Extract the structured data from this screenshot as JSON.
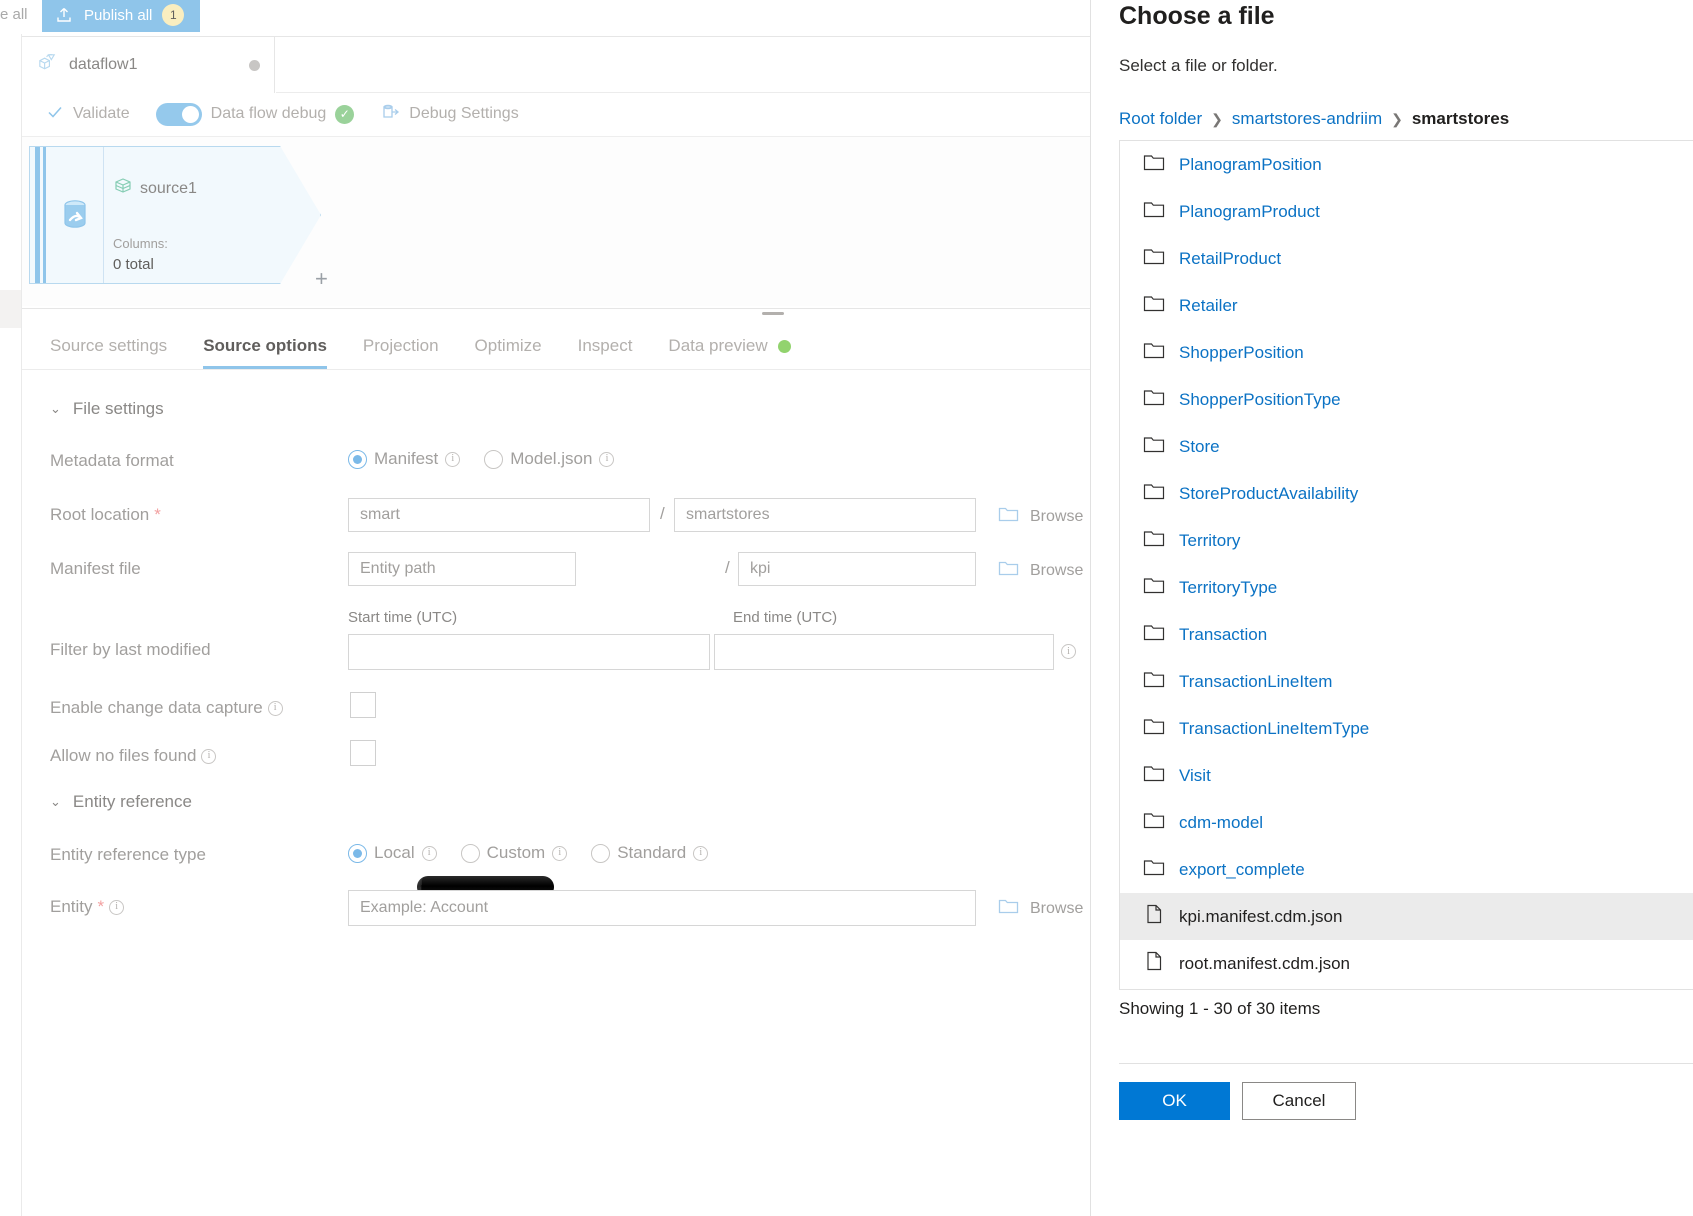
{
  "toolbar": {
    "discard_label": "e all",
    "publish_label": "Publish all",
    "publish_icon": "publish-upload-icon",
    "publish_count": "1"
  },
  "dataflow_tab": {
    "name": "dataflow1",
    "icon": "dataflow-icon",
    "status_dot": "unsaved-dot"
  },
  "command_bar": {
    "validate": {
      "label": "Validate",
      "icon": "check-icon"
    },
    "debug_toggle": {
      "label": "Data flow debug",
      "state": "on",
      "status_icon": "check-circle-green-icon"
    },
    "debug_settings": {
      "label": "Debug Settings",
      "icon": "debug-settings-icon"
    }
  },
  "canvas": {
    "node": {
      "icon": "source-database-icon",
      "side_icon": "source-stream-icon",
      "name": "source1",
      "columns_label": "Columns:",
      "columns_value": "0 total",
      "add_label": "+"
    }
  },
  "detail_tabs": [
    {
      "label": "Source settings",
      "active": false
    },
    {
      "label": "Source options",
      "active": true
    },
    {
      "label": "Projection",
      "active": false
    },
    {
      "label": "Optimize",
      "active": false
    },
    {
      "label": "Inspect",
      "active": false
    },
    {
      "label": "Data preview",
      "active": false,
      "dot": true
    }
  ],
  "form": {
    "file_settings_header": "File settings",
    "entity_reference_header": "Entity reference",
    "metadata_format": {
      "label": "Metadata format",
      "options": [
        {
          "label": "Manifest",
          "selected": true
        },
        {
          "label": "Model.json",
          "selected": false
        }
      ]
    },
    "root_location": {
      "label": "Root location",
      "required": "*",
      "container_value": "smart",
      "container_redacted": true,
      "separator": "/",
      "folder_value": "smartstores",
      "browse_label": "Browse",
      "browse_icon": "folder-icon"
    },
    "manifest_file": {
      "label": "Manifest file",
      "entity_path_placeholder": "Entity path",
      "separator": "/",
      "file_value": "kpi",
      "browse_label": "Browse",
      "browse_icon": "folder-icon"
    },
    "filter_by_last_modified": {
      "label": "Filter by last modified",
      "start_label": "Start time (UTC)",
      "end_label": "End time (UTC)",
      "start_value": "",
      "end_value": "",
      "info_icon": "info-icon"
    },
    "enable_cdc": {
      "label": "Enable change data capture",
      "checked": false,
      "info_icon": "info-icon"
    },
    "allow_no_files": {
      "label": "Allow no files found",
      "checked": false,
      "info_icon": "info-icon"
    },
    "entity_reference_type": {
      "label": "Entity reference type",
      "options": [
        {
          "label": "Local",
          "selected": true
        },
        {
          "label": "Custom",
          "selected": false
        },
        {
          "label": "Standard",
          "selected": false
        }
      ]
    },
    "entity": {
      "label": "Entity",
      "required": "*",
      "placeholder": "Example: Account",
      "browse_label": "Browse",
      "browse_icon": "folder-icon",
      "info_icon": "info-icon"
    }
  },
  "panel": {
    "title": "Choose a file",
    "subtitle": "Select a file or folder.",
    "breadcrumb": [
      {
        "label": "Root folder",
        "current": false
      },
      {
        "label": "smartstores-andriim",
        "current": false
      },
      {
        "label": "smartstores",
        "current": true
      }
    ],
    "breadcrumb_separator": "❯",
    "items": [
      {
        "name": "PlanogramPosition",
        "type": "folder",
        "selected": false
      },
      {
        "name": "PlanogramProduct",
        "type": "folder",
        "selected": false
      },
      {
        "name": "RetailProduct",
        "type": "folder",
        "selected": false
      },
      {
        "name": "Retailer",
        "type": "folder",
        "selected": false
      },
      {
        "name": "ShopperPosition",
        "type": "folder",
        "selected": false
      },
      {
        "name": "ShopperPositionType",
        "type": "folder",
        "selected": false
      },
      {
        "name": "Store",
        "type": "folder",
        "selected": false
      },
      {
        "name": "StoreProductAvailability",
        "type": "folder",
        "selected": false
      },
      {
        "name": "Territory",
        "type": "folder",
        "selected": false
      },
      {
        "name": "TerritoryType",
        "type": "folder",
        "selected": false
      },
      {
        "name": "Transaction",
        "type": "folder",
        "selected": false
      },
      {
        "name": "TransactionLineItem",
        "type": "folder",
        "selected": false
      },
      {
        "name": "TransactionLineItemType",
        "type": "folder",
        "selected": false
      },
      {
        "name": "Visit",
        "type": "folder",
        "selected": false
      },
      {
        "name": "cdm-model",
        "type": "folder",
        "selected": false
      },
      {
        "name": "export_complete",
        "type": "folder",
        "selected": false
      },
      {
        "name": "kpi.manifest.cdm.json",
        "type": "file",
        "selected": true
      },
      {
        "name": "root.manifest.cdm.json",
        "type": "file",
        "selected": false
      }
    ],
    "showing_text": "Showing 1 - 30 of 30 items",
    "ok_label": "OK",
    "cancel_label": "Cancel"
  },
  "colors": {
    "accent_blue": "#0078d4",
    "link_blue": "#0b72c4",
    "toggle_blue": "#8fc5ea",
    "success_green": "#92d36e",
    "selected_row": "#ebebeb"
  }
}
